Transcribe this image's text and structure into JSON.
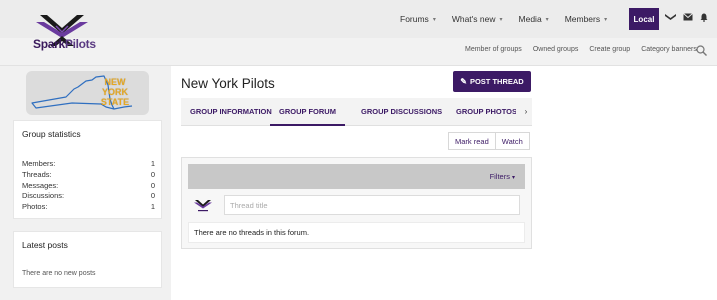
{
  "brand": {
    "name_part1": "Spark",
    "name_part2": "Pilots",
    "logo_icon": "sparkpilots-wings-logo",
    "accent_color": "#3c1a65"
  },
  "topnav": {
    "items": [
      {
        "label": "Forums",
        "caret": "▾"
      },
      {
        "label": "What's new",
        "caret": "▾"
      },
      {
        "label": "Media",
        "caret": "▾"
      },
      {
        "label": "Members",
        "caret": "▾"
      }
    ],
    "active": {
      "label": "Local"
    },
    "icons": [
      "plane-icon",
      "mail-icon",
      "bell-icon"
    ]
  },
  "subnav": {
    "items": [
      "Member of groups",
      "Owned groups",
      "Create group",
      "Category banners"
    ],
    "search_icon": "search-icon"
  },
  "sidebar": {
    "banner": {
      "text": "NEW YORK STATE",
      "line1": "NEW",
      "line2": "YORK",
      "line3": "STATE",
      "text_color": "#e5a824"
    },
    "stats": {
      "title": "Group statistics",
      "rows": [
        {
          "label": "Members:",
          "value": "1"
        },
        {
          "label": "Threads:",
          "value": "0"
        },
        {
          "label": "Messages:",
          "value": "0"
        },
        {
          "label": "Discussions:",
          "value": "0"
        },
        {
          "label": "Photos:",
          "value": "1"
        }
      ]
    },
    "latest": {
      "title": "Latest posts",
      "empty_text": "There are no new posts"
    }
  },
  "main": {
    "title": "New York Pilots",
    "post_button": {
      "label": "POST THREAD",
      "icon": "pencil-icon"
    },
    "tabs": [
      {
        "label": "GROUP INFORMATION",
        "active": false
      },
      {
        "label": "GROUP FORUM",
        "active": true
      },
      {
        "label": "GROUP DISCUSSIONS",
        "active": false
      },
      {
        "label": "GROUP PHOTOS",
        "active": false
      }
    ],
    "tabs_scroll_arrow": "›",
    "actions": {
      "mark_read": "Mark read",
      "watch": "Watch"
    },
    "forum": {
      "filters_label": "Filters",
      "filters_caret": "▾",
      "thread_placeholder": "Thread title",
      "thread_value": "",
      "empty_text": "There are no threads in this forum."
    }
  }
}
